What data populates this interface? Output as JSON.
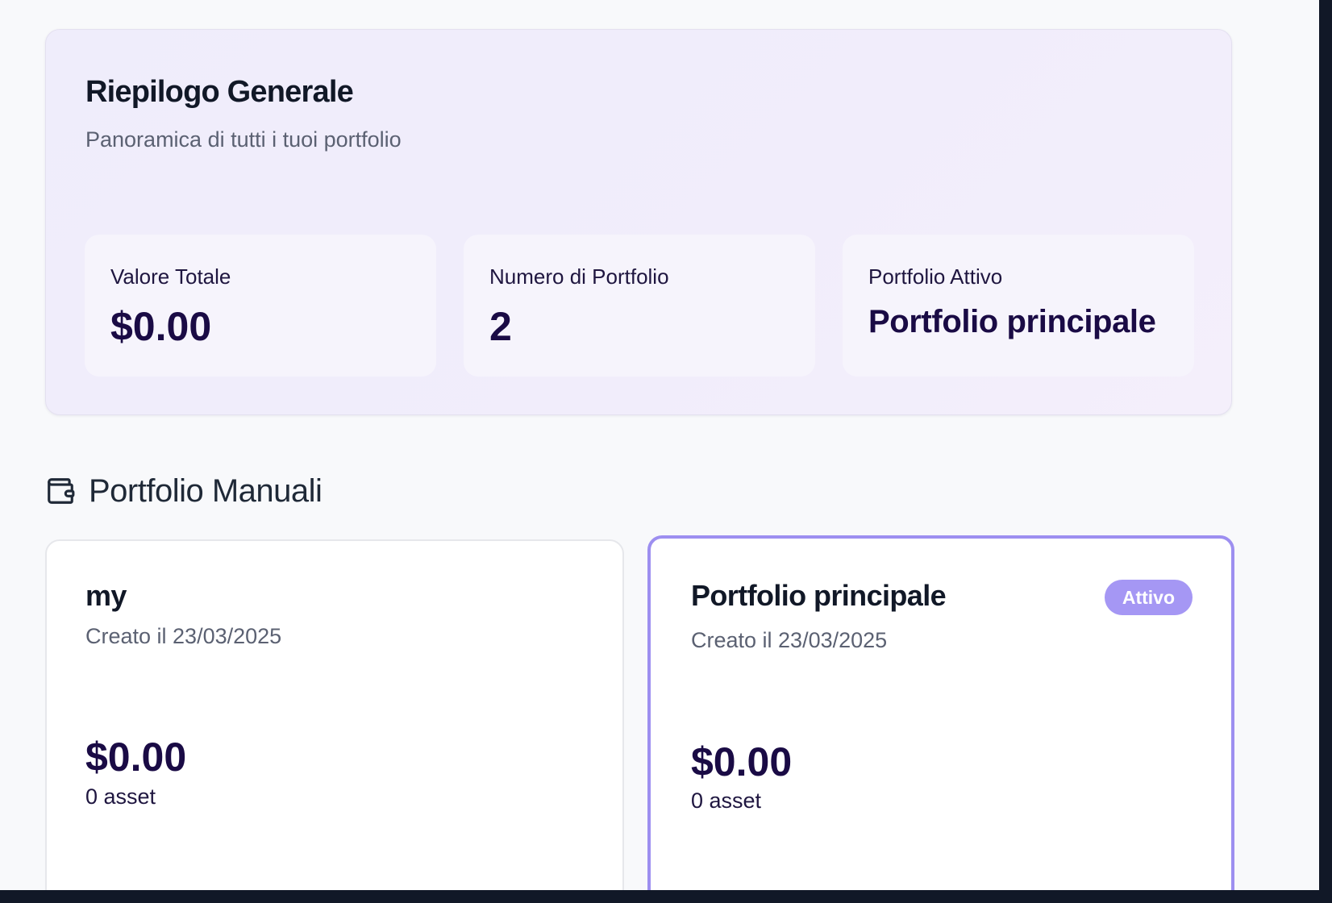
{
  "summary": {
    "title": "Riepilogo Generale",
    "subtitle": "Panoramica di tutti i tuoi portfolio",
    "stats": [
      {
        "label": "Valore Totale",
        "value": "$0.00"
      },
      {
        "label": "Numero di Portfolio",
        "value": "2"
      },
      {
        "label": "Portfolio Attivo",
        "value": "Portfolio principale"
      }
    ]
  },
  "section": {
    "icon": "wallet-icon",
    "title": "Portfolio Manuali"
  },
  "portfolios": [
    {
      "name": "my",
      "created": "Creato il 23/03/2025",
      "value": "$0.00",
      "assets": "0 asset",
      "active": false
    },
    {
      "name": "Portfolio principale",
      "created": "Creato il 23/03/2025",
      "value": "$0.00",
      "assets": "0 asset",
      "active": true,
      "badge": "Attivo"
    }
  ],
  "colors": {
    "accent": "#9d8ff0",
    "badge": "#a597f4",
    "value_text": "#1a0b45"
  }
}
